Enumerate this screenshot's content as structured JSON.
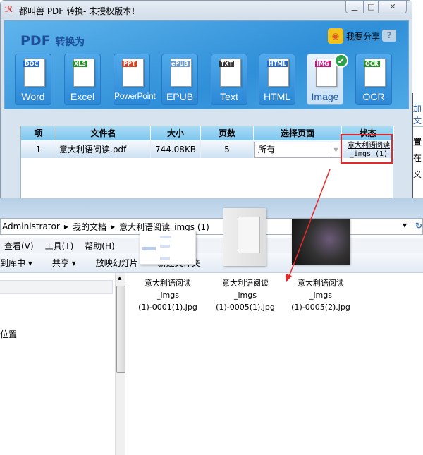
{
  "app": {
    "title": "都叫兽 PDF 转换- 未授权版本！",
    "heading_pdf": "PDF",
    "heading_rest": "转换为",
    "share_label": "我要分享",
    "help": "?",
    "formats": [
      {
        "label": "Word",
        "tag": "DOC",
        "color": "#2a66c4"
      },
      {
        "label": "Excel",
        "tag": "XLS",
        "color": "#2b8a2b"
      },
      {
        "label": "PowerPoint",
        "tag": "PPT",
        "color": "#d2452a"
      },
      {
        "label": "EPUB",
        "tag": "ePUB",
        "color": "#6f9bd3"
      },
      {
        "label": "Text",
        "tag": "TXT",
        "color": "#333333"
      },
      {
        "label": "HTML",
        "tag": "HTML",
        "color": "#2a66c4"
      },
      {
        "label": "Image",
        "tag": "IMG",
        "color": "#c2177a",
        "selected": true
      },
      {
        "label": "OCR",
        "tag": "OCR",
        "color": "#2b8a2b"
      }
    ],
    "table": {
      "headers": [
        "项",
        "文件名",
        "大小",
        "页数",
        "选择页面",
        "状态"
      ],
      "rows": [
        {
          "index": "1",
          "filename": "意大利语阅读.pdf",
          "size": "744.08KB",
          "pages": "5",
          "page_select": "所有",
          "status_line1": "意大利语阅读",
          "status_line2": "_imgs (1)"
        }
      ]
    }
  },
  "background_window": {
    "lines": [
      "加文",
      "置",
      "在",
      "义"
    ]
  },
  "explorer": {
    "breadcrumb": [
      "Administrator",
      "我的文档",
      "意大利语阅读_imgs (1)"
    ],
    "menu": [
      "查看(V)",
      "工具(T)",
      "帮助(H)"
    ],
    "toolbar": [
      "到库中 ▾",
      "共享 ▾",
      "放映幻灯片",
      "新建文件夹"
    ],
    "nav_item": "位置",
    "files": [
      {
        "line1": "意大利语阅读",
        "line2": "_imgs",
        "line3": "(1)-0001(1).jpg"
      },
      {
        "line1": "意大利语阅读",
        "line2": "_imgs",
        "line3": "(1)-0005(1).jpg"
      },
      {
        "line1": "意大利语阅读",
        "line2": "_imgs",
        "line3": "(1)-0005(2).jpg"
      }
    ]
  },
  "annotation_color": "#e52828"
}
